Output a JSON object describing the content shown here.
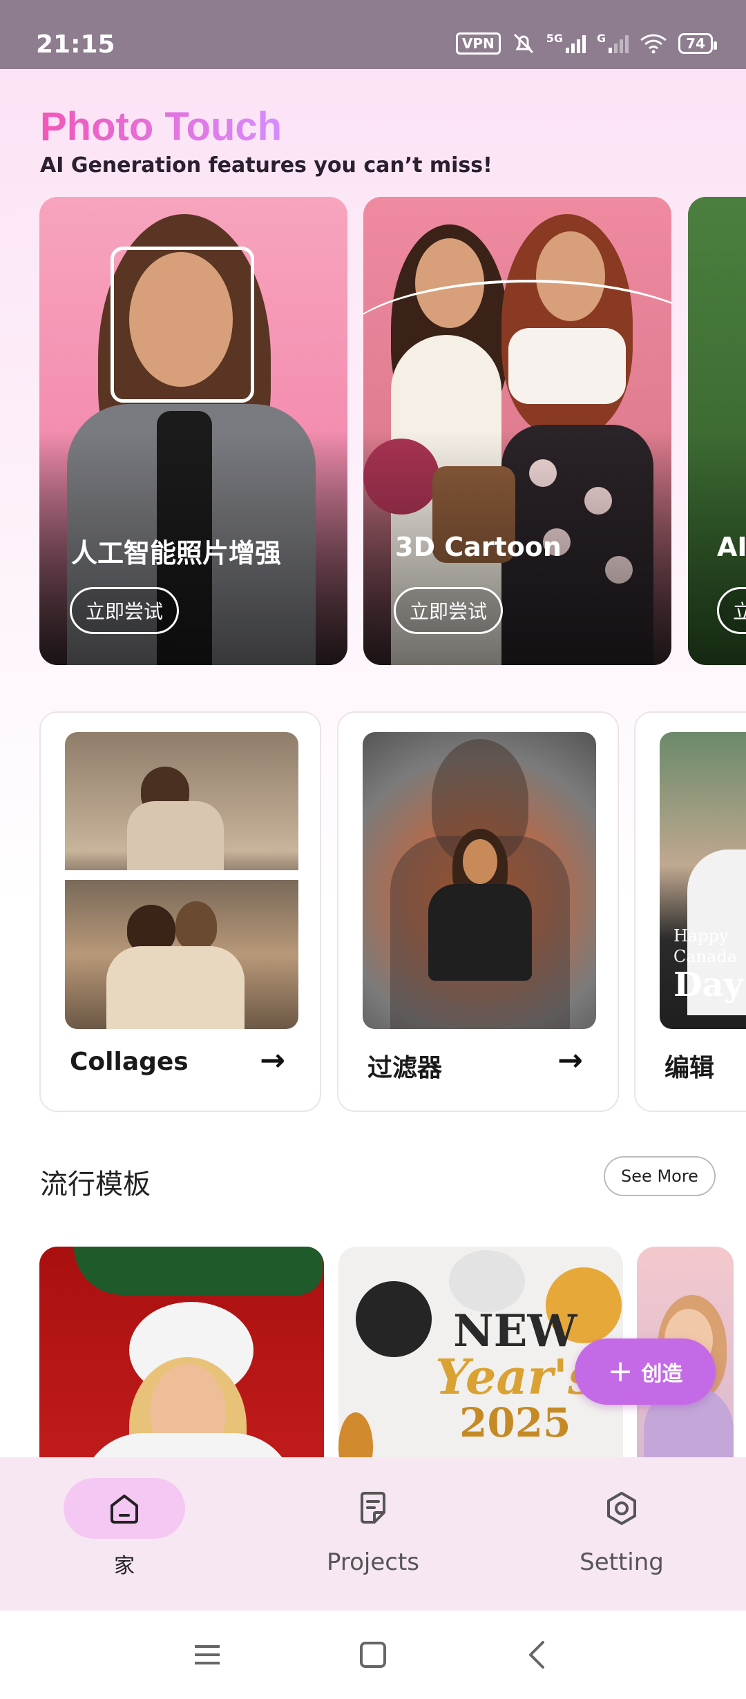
{
  "status_bar": {
    "time": "21:15",
    "vpn": "VPN",
    "network_1": "5G",
    "network_2": "G",
    "battery": "74"
  },
  "header": {
    "title": "Photo Touch",
    "subtitle": "AI Generation features you can’t miss!"
  },
  "hero_cards": [
    {
      "label": "人工智能照片增强",
      "button": "立即尝试"
    },
    {
      "label": "3D Cartoon",
      "button": "立即尝试"
    },
    {
      "label": "AI",
      "button": "立"
    }
  ],
  "feature_cards": [
    {
      "label": "Collages",
      "arrow": "→"
    },
    {
      "label": "过滤器",
      "arrow": "→"
    },
    {
      "label": "编辑",
      "overlay_line1": "Happy",
      "overlay_line2": "Canada",
      "overlay_line3": "Day"
    }
  ],
  "templates_section": {
    "title": "流行模板",
    "see_more": "See More",
    "new_year_line1": "NEW",
    "new_year_line2": "Year's",
    "new_year_line3": "2025"
  },
  "fab": {
    "icon": "plus-icon",
    "label": "创造"
  },
  "bottom_nav": {
    "items": [
      {
        "label": "家",
        "icon": "home-icon",
        "active": true
      },
      {
        "label": "Projects",
        "icon": "document-icon",
        "active": false
      },
      {
        "label": "Setting",
        "icon": "settings-icon",
        "active": false
      }
    ]
  },
  "colors": {
    "brand_pink": "#f06bc7",
    "fab_purple": "#c56ae6",
    "nav_active": "#f5c8f3"
  }
}
